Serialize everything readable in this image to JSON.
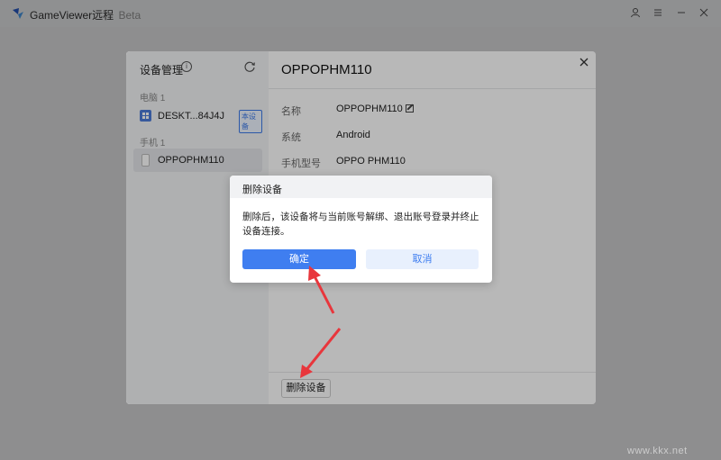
{
  "titlebar": {
    "app_name": "GameViewer远程",
    "beta": "Beta",
    "icons": [
      "user-icon",
      "menu-icon",
      "minimize-icon",
      "close-icon"
    ]
  },
  "device_manager": {
    "title": "设备管理",
    "groups": [
      {
        "label": "电脑 1",
        "devices": [
          {
            "name": "DESKT...84J4J",
            "badge": "本设备",
            "icon": "windows-pc-icon"
          }
        ]
      },
      {
        "label": "手机 1",
        "devices": [
          {
            "name": "OPPOPHM110",
            "icon": "phone-icon",
            "selected": true
          }
        ]
      }
    ],
    "detail": {
      "title": "OPPOPHM110",
      "properties": [
        {
          "label": "名称",
          "value": "OPPOPHM110"
        },
        {
          "label": "系统",
          "value": "Android"
        },
        {
          "label": "手机型号",
          "value": "OPPO PHM110"
        }
      ],
      "delete_button": "删除设备"
    }
  },
  "confirm_dialog": {
    "title": "删除设备",
    "message": "删除后，该设备将与当前账号解绑、退出账号登录并终止设备连接。",
    "ok_label": "确定",
    "cancel_label": "取消"
  },
  "watermark": "www.kkx.net",
  "colors": {
    "primary": "#3f7ef0",
    "annotation_arrow": "#e8363c"
  }
}
